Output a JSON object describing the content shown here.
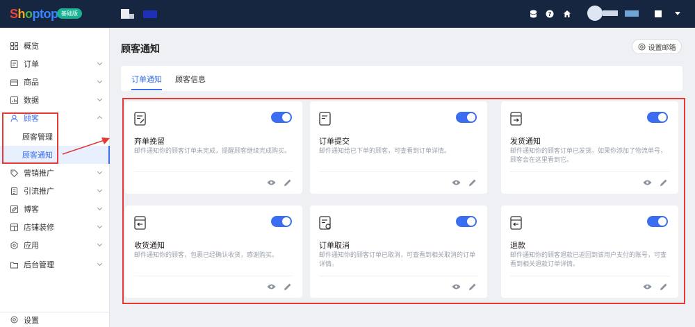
{
  "header": {
    "logo_text": "Shoptop",
    "plan_badge": "基础版",
    "icons": [
      "database-icon",
      "help-icon",
      "home-icon"
    ],
    "colors": {
      "bar": "#172640",
      "badge": "#19b394"
    }
  },
  "sidebar": {
    "items": [
      {
        "label": "概览",
        "icon": "dashboard-icon",
        "has_arrow": false
      },
      {
        "label": "订单",
        "icon": "order-icon",
        "has_arrow": true
      },
      {
        "label": "商品",
        "icon": "product-icon",
        "has_arrow": true
      },
      {
        "label": "数据",
        "icon": "chart-icon",
        "has_arrow": true
      },
      {
        "label": "顾客",
        "icon": "user-icon",
        "has_arrow": true,
        "expanded": true
      },
      {
        "label": "营销推广",
        "icon": "tag-icon",
        "has_arrow": true
      },
      {
        "label": "引流推广",
        "icon": "doc-icon",
        "has_arrow": true
      },
      {
        "label": "博客",
        "icon": "blog-icon",
        "has_arrow": true
      },
      {
        "label": "店铺装修",
        "icon": "store-icon",
        "has_arrow": true
      },
      {
        "label": "应用",
        "icon": "app-icon",
        "has_arrow": true
      },
      {
        "label": "后台管理",
        "icon": "folder-icon",
        "has_arrow": true
      }
    ],
    "customer_sub": [
      {
        "label": "顾客管理",
        "active": false
      },
      {
        "label": "顾客通知",
        "active": true
      }
    ],
    "settings_label": "设置"
  },
  "main": {
    "title": "顾客通知",
    "mailbox_button": "设置邮箱",
    "tabs": [
      {
        "label": "订单通知",
        "active": true
      },
      {
        "label": "顾客信息",
        "active": false
      }
    ],
    "cards": [
      {
        "title": "弃单挽留",
        "desc": "邮件通知你的顾客订单未完成，提醒顾客继续完成购买。",
        "icon": "abandon-icon",
        "enabled": true
      },
      {
        "title": "订单提交",
        "desc": "邮件通知给已下单的顾客，可查看到订单详情。",
        "icon": "submit-icon",
        "enabled": true
      },
      {
        "title": "发货通知",
        "desc": "邮件通知你的顾客订单已发货。如果你添加了物流单号，顾客会在这里看到它。",
        "icon": "ship-icon",
        "enabled": true
      },
      {
        "title": "收货通知",
        "desc": "邮件通知你的顾客，包裹已经确认收货，感谢购买。",
        "icon": "receive-icon",
        "enabled": true
      },
      {
        "title": "订单取消",
        "desc": "邮件通知你的顾客订单已取消，可查看到相关取消的订单详情。",
        "icon": "cancel-icon",
        "enabled": true
      },
      {
        "title": "退款",
        "desc": "邮件通知你的顾客退款已返回到该用户支付的账号，可查看到相关退款订单详情。",
        "icon": "refund-icon",
        "enabled": true
      }
    ],
    "accent_color": "#3a6df0",
    "highlight_color": "#e53935"
  }
}
